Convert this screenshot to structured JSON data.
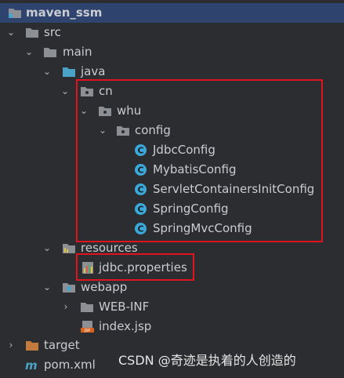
{
  "project": {
    "name": "maven_ssm"
  },
  "tree": {
    "src": "src",
    "main": "main",
    "java": "java",
    "cn": "cn",
    "whu": "whu",
    "config": "config",
    "classes": [
      "JdbcConfig",
      "MybatisConfig",
      "ServletContainersInitConfig",
      "SpringConfig",
      "SpringMvcConfig"
    ],
    "resources": "resources",
    "jdbc_properties": "jdbc.properties",
    "webapp": "webapp",
    "web_inf": "WEB-INF",
    "index_jsp": "index.jsp",
    "target": "target",
    "pom": "pom.xml"
  },
  "icons": {
    "folder": "folder-icon",
    "source_folder": "source-root-icon",
    "resources_folder": "resources-root-icon",
    "package": "package-icon",
    "class": "class-icon",
    "properties": "properties-file-icon",
    "jsp": "jsp-file-icon",
    "maven": "maven-icon",
    "web": "web-folder-icon"
  },
  "colors": {
    "background": "#2b2d30",
    "text": "#c9ccd1",
    "folder": "#8c8f94",
    "source_root": "#4aa3c7",
    "class_icon": "#3aa8d8",
    "target_folder": "#c47a3d",
    "selection": "#2e436e",
    "annotation": "#e0141e"
  },
  "watermark": "CSDN @奇迹是执着的人创造的"
}
